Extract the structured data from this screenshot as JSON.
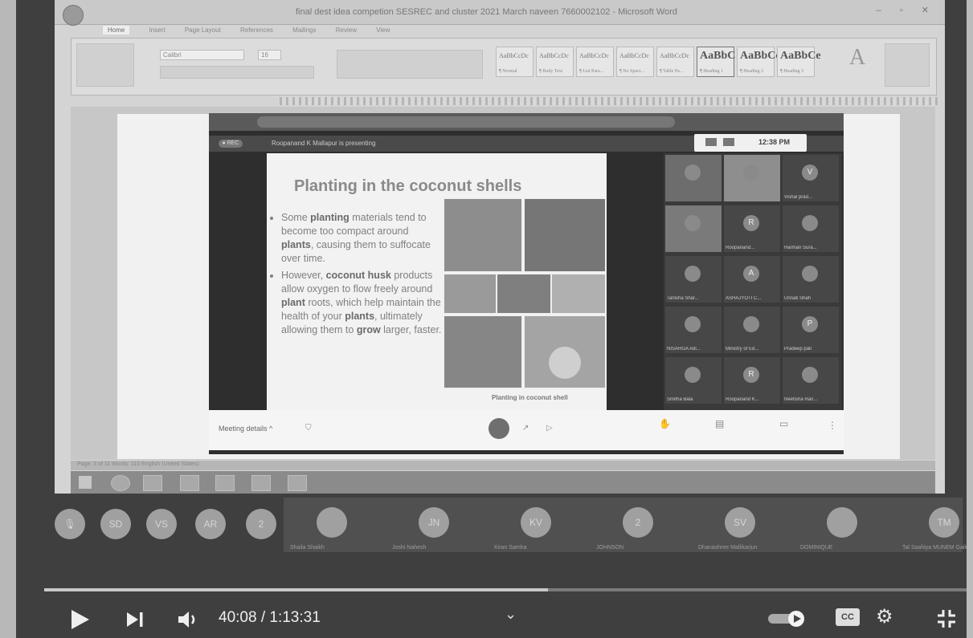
{
  "word": {
    "title": "final dest idea competion SESREC and cluster 2021 March naveen 7660002102 - Microsoft Word",
    "ribbon_tabs": [
      "Home",
      "Insert",
      "Page Layout",
      "References",
      "Mailings",
      "Review",
      "View"
    ],
    "font_name": "Calibri",
    "font_size": "16",
    "styles": [
      {
        "sample": "AaBbCcDc",
        "name": "¶ Normal"
      },
      {
        "sample": "AaBbCcDc",
        "name": "¶ Body Text"
      },
      {
        "sample": "AaBbCcDc",
        "name": "¶ List Para..."
      },
      {
        "sample": "AaBbCcDc",
        "name": "¶ No Spaci..."
      },
      {
        "sample": "AaBbCcDc",
        "name": "¶ Table Pa..."
      },
      {
        "sample": "AaBbC",
        "name": "¶ Heading 1"
      },
      {
        "sample": "AaBbCc",
        "name": "¶ Heading 2"
      },
      {
        "sample": "AaBbCe",
        "name": "¶ Heading 3"
      }
    ],
    "status": "Page: 3 of 11   Words: 110   English (United States)"
  },
  "meet": {
    "presenting": "Roopanand K Mallapur is presenting",
    "clock": "12:38 PM",
    "meeting_details": "Meeting details",
    "caption": "Planting in coconut shell"
  },
  "slide": {
    "title": "Planting in the coconut shells",
    "bullet1": {
      "a": "Some ",
      "b1": "planting",
      "c": " materials tend to become too compact around ",
      "b2": "plants",
      "d": ", causing them to suffocate over time."
    },
    "bullet2": {
      "a": "However, ",
      "b1": "coconut husk",
      "c": " products allow oxygen to flow freely around ",
      "b2": "plant",
      "d": " roots, which help maintain the health of your ",
      "b3": "plants",
      "e": ", ultimately allowing them to ",
      "b4": "grow",
      "f": " larger, faster."
    }
  },
  "grid_tiles": [
    "",
    "",
    "Vishal prad...",
    "",
    "Roopanand...",
    "Harman Sura...",
    "Tanisha Shar...",
    "ASHAJYOTI C...",
    "Unnati Shah",
    "NISARGA Adi...",
    "Ministry of Ed...",
    "Pradeep pati",
    "Smitha Bala",
    "Roopanand K...",
    "Neetisha Ran..."
  ],
  "grid_initials": [
    "",
    "",
    "V",
    "",
    "R",
    "",
    "",
    "A",
    "",
    "",
    "",
    "P",
    "",
    "R",
    ""
  ],
  "strip": {
    "circles": [
      "SD",
      "VS",
      "AR",
      "2"
    ],
    "tiles": [
      {
        "initials": "",
        "name": "Shaila Shaikh"
      },
      {
        "initials": "JN",
        "name": "Joshi Nahesh"
      },
      {
        "initials": "KV",
        "name": "Kiran Samha"
      },
      {
        "initials": "2",
        "name": "JOHNSON"
      },
      {
        "initials": "SV",
        "name": "Dhanashree Mallikarjun"
      },
      {
        "initials": "",
        "name": "DOMINIQUE"
      },
      {
        "initials": "TM",
        "name": "Tal Saahiya MUNEM Gaikh"
      }
    ]
  },
  "player": {
    "time": "40:08 / 1:13:31",
    "cc_label": "CC",
    "progress": 0.545
  }
}
